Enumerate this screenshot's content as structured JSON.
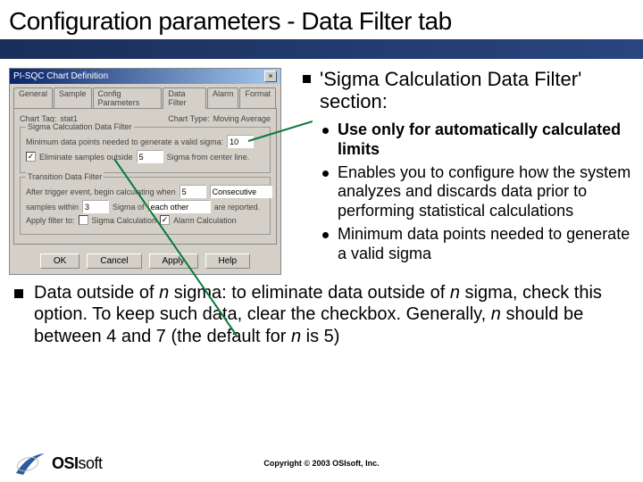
{
  "title": "Configuration parameters - Data Filter tab",
  "dialog": {
    "titlebar": "PI-SQC Chart Definition",
    "tabs": [
      "General",
      "Sample",
      "Config Parameters",
      "Data Filter",
      "Alarm",
      "Format"
    ],
    "active_tab_index": 3,
    "chart_tag_label": "Chart Tag:",
    "chart_tag_value": "stat1",
    "chart_type_label": "Chart Type:",
    "chart_type_value": "Moving Average",
    "group1": {
      "legend": "Sigma Calculation Data Filter",
      "min_points_label": "Minimum data points needed to generate a valid sigma:",
      "min_points_value": "10",
      "elim_label": "Eliminate samples outside",
      "elim_checked": true,
      "elim_value": "5",
      "elim_suffix": "Sigma from center line."
    },
    "group2": {
      "legend": "Transition Data Filter",
      "after_label": "After trigger event, begin calculating when",
      "after_value": "5",
      "after_mode": "Consecutive",
      "samples_label": "samples within",
      "samples_value": "3",
      "samples_mid": "Sigma of",
      "samples_of": "each other",
      "samples_suffix": "are reported.",
      "apply_label": "Apply filter to:",
      "apply_sigma_label": "Sigma Calculation",
      "apply_sigma_checked": false,
      "apply_alarm_label": "Alarm Calculation",
      "apply_alarm_checked": true
    },
    "buttons": {
      "ok": "OK",
      "cancel": "Cancel",
      "apply": "Apply",
      "help": "Help"
    }
  },
  "lead": "'Sigma Calculation Data Filter' section:",
  "subs": [
    "Use only for automatically calculated limits",
    "Enables you to configure how the system analyzes and discards data prior to performing statistical calculations",
    "Minimum data points needed to generate a valid sigma"
  ],
  "bottom": {
    "p1": "Data outside of ",
    "n1": "n",
    "p2": " sigma: to eliminate data outside of ",
    "n2": "n",
    "p3": " sigma, check this option. To keep such data, clear the checkbox. Generally, ",
    "n3": "n",
    "p4": " should be between 4 and 7 (the default for ",
    "n4": "n ",
    "p5": " is 5)"
  },
  "footer": {
    "brand_bold": "OSI",
    "brand_soft": "soft",
    "copyright": "Copyright © 2003 OSIsoft, Inc."
  }
}
